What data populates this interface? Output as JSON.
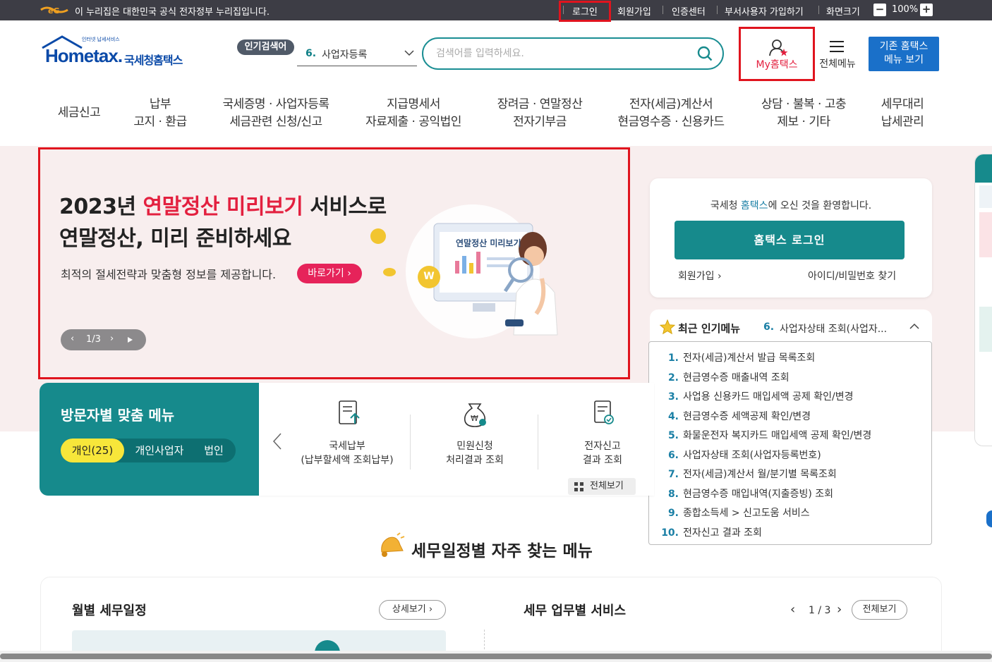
{
  "topbar": {
    "gov_notice": "이 누리집은 대한민국 공식 전자정부 누리집입니다.",
    "links": [
      "로그인",
      "회원가입",
      "인증센터",
      "부서사용자 가입하기",
      "화면크기"
    ],
    "zoom": "100%",
    "zoom_minus": "−",
    "zoom_plus": "+"
  },
  "logo": {
    "sub": "인터넷 납세서비스",
    "main": "Hometax.",
    "kr": "국세청홈택스"
  },
  "popular": {
    "badge": "인기검색어",
    "num": "6.",
    "text": "사업자등록"
  },
  "search": {
    "placeholder": "검색어를 입력하세요."
  },
  "header": {
    "my_hometax": "My홈택스",
    "all_menu": "전체메뉴",
    "old_home_line1": "기존 홈택스",
    "old_home_line2": "메뉴 보기"
  },
  "nav": [
    {
      "line1": "세금신고",
      "line2": ""
    },
    {
      "line1": "납부",
      "line2": "고지 · 환급"
    },
    {
      "line1": "국세증명 · 사업자등록",
      "line2": "세금관련 신청/신고"
    },
    {
      "line1": "지급명세서",
      "line2": "자료제출 · 공익법인"
    },
    {
      "line1": "장려금 · 연말정산",
      "line2": "전자기부금"
    },
    {
      "line1": "전자(세금)계산서",
      "line2": "현금영수증 · 신용카드"
    },
    {
      "line1": "상담 · 불복 · 고충",
      "line2": "제보 · 기타"
    },
    {
      "line1": "세무대리",
      "line2": "납세관리"
    }
  ],
  "hero": {
    "title_a": "2023년 ",
    "title_pink": "연말정산 미리보기",
    "title_b": " 서비스로",
    "title_line2": "연말정산, 미리 준비하세요",
    "subtitle": "최적의 절세전략과 맞춤형 정보를 제공합니다.",
    "go_button": "바로가기",
    "pager": "1/3",
    "monitor_label": "연말정산 미리보기",
    "coin": "W"
  },
  "login_card": {
    "welcome_a": "국세청 ",
    "welcome_hl": "홈택스",
    "welcome_b": "에 오신 것을 환영합니다.",
    "login_button": "홈택스 로그인",
    "signup": "회원가입",
    "find": "아이디/비밀번호 찾기"
  },
  "recent_popular": {
    "title": "최근 인기메뉴",
    "current_num": "6.",
    "current_text": "사업자상태 조회(사업자...",
    "items": [
      {
        "n": "1.",
        "t": "전자(세금)계산서 발급 목록조회"
      },
      {
        "n": "2.",
        "t": "현금영수증 매출내역 조회"
      },
      {
        "n": "3.",
        "t": "사업용 신용카드 매입세액 공제 확인/변경"
      },
      {
        "n": "4.",
        "t": "현금영수증 세액공제 확인/변경"
      },
      {
        "n": "5.",
        "t": "화물운전자 복지카드 매입세액 공제 확인/변경"
      },
      {
        "n": "6.",
        "t": "사업자상태 조회(사업자등록번호)"
      },
      {
        "n": "7.",
        "t": "전자(세금)계산서 월/분기별 목록조회"
      },
      {
        "n": "8.",
        "t": "현금영수증 매입내역(지출증빙) 조회"
      },
      {
        "n": "9.",
        "t": "종합소득세 > 신고도움 서비스"
      },
      {
        "n": "10.",
        "t": "전자신고 결과 조회"
      }
    ]
  },
  "visitor_menu": {
    "title": "방문자별 맞춤 메뉴",
    "tabs": [
      "개인(25)",
      "개인사업자",
      "법인"
    ],
    "items": [
      {
        "line1": "국세납부",
        "line2": "(납부할세액 조회납부)"
      },
      {
        "line1": "민원신청",
        "line2": "처리결과 조회"
      },
      {
        "line1": "전자신고",
        "line2": "결과 조회"
      }
    ],
    "view_all": "전체보기"
  },
  "schedule": {
    "title": "세무일정별 자주 찾는 메뉴",
    "monthly": "월별 세무일정",
    "detail_btn": "상세보기",
    "services": "세무 업무별 서비스",
    "page": "1 / 3",
    "view_all": "전체보기"
  },
  "colors": {
    "teal": "#168a8c",
    "pink": "#e3203f",
    "blue": "#1a70c9",
    "hero_bg": "#f8eeee"
  }
}
